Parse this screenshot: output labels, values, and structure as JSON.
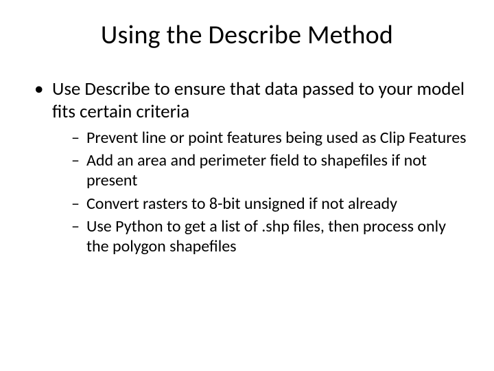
{
  "title": "Using the Describe Method",
  "bullets": [
    {
      "text": "Use Describe to ensure that data passed to your model fits certain criteria",
      "sub": [
        "Prevent line or point features being used as Clip Features",
        "Add an area and perimeter field to shapefiles if not present",
        "Convert rasters to 8-bit unsigned if not already",
        "Use Python to get a list of .shp files, then process only the polygon shapefiles"
      ]
    }
  ]
}
